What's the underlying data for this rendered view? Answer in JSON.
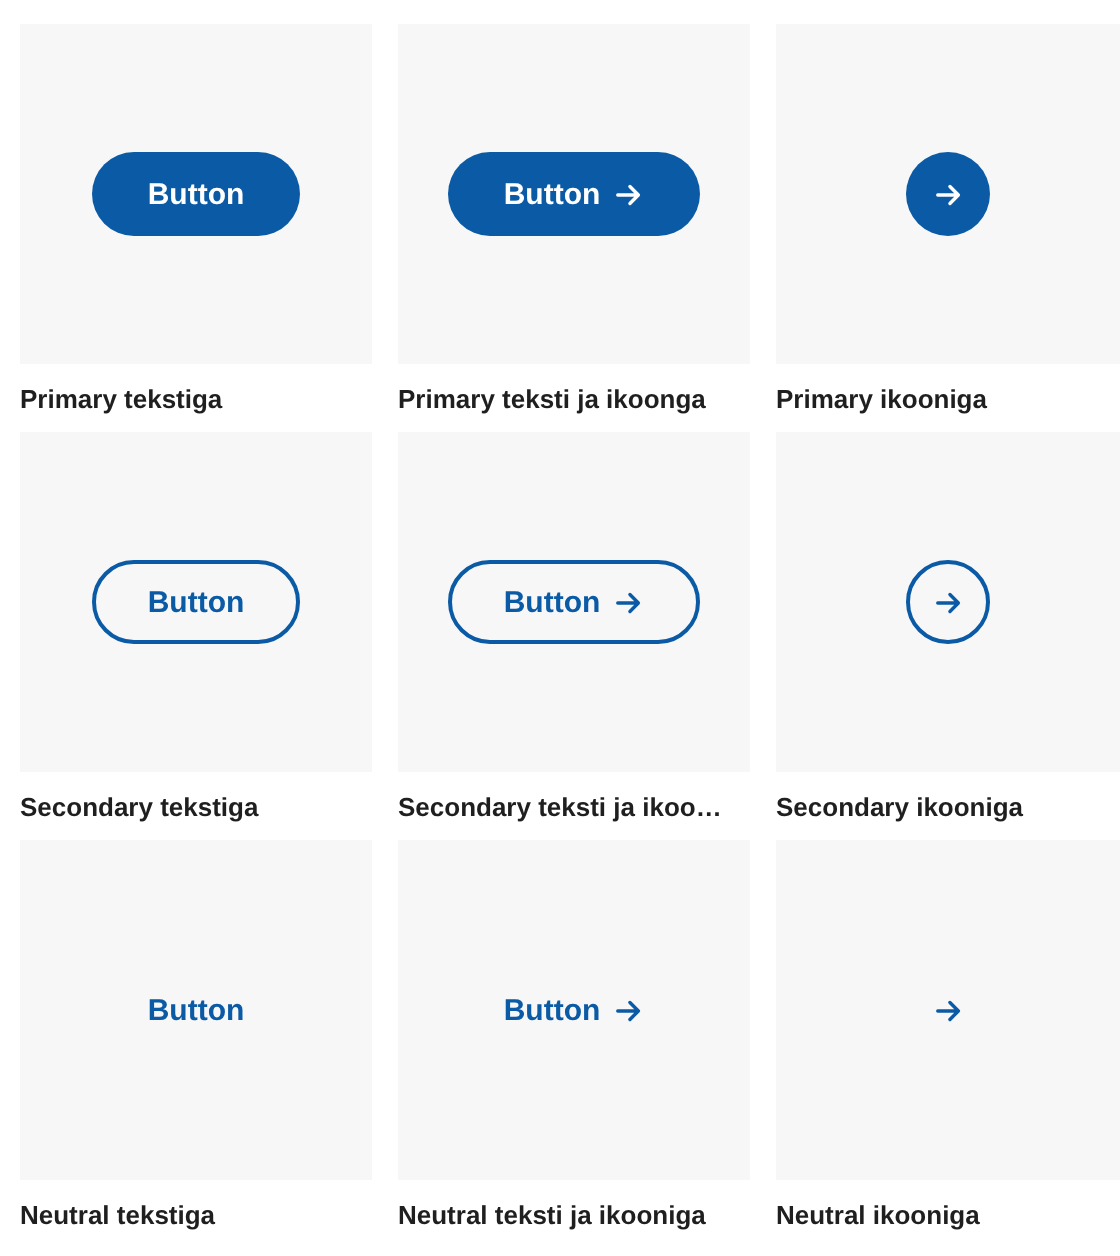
{
  "examples": [
    {
      "kind": "primary-text",
      "button": "Button",
      "caption": "Primary tekstiga"
    },
    {
      "kind": "primary-text-icon",
      "button": "Button",
      "caption": "Primary teksti ja ikoonga"
    },
    {
      "kind": "primary-icon",
      "caption": "Primary ikooniga"
    },
    {
      "kind": "secondary-text",
      "button": "Button",
      "caption": "Secondary tekstiga"
    },
    {
      "kind": "secondary-text-icon",
      "button": "Button",
      "caption": "Secondary teksti ja ikoo…"
    },
    {
      "kind": "secondary-icon",
      "caption": "Secondary ikooniga"
    },
    {
      "kind": "neutral-text",
      "button": "Button",
      "caption": "Neutral tekstiga"
    },
    {
      "kind": "neutral-text-icon",
      "button": "Button",
      "caption": "Neutral teksti ja ikooniga"
    },
    {
      "kind": "neutral-icon",
      "caption": "Neutral ikooniga"
    }
  ]
}
